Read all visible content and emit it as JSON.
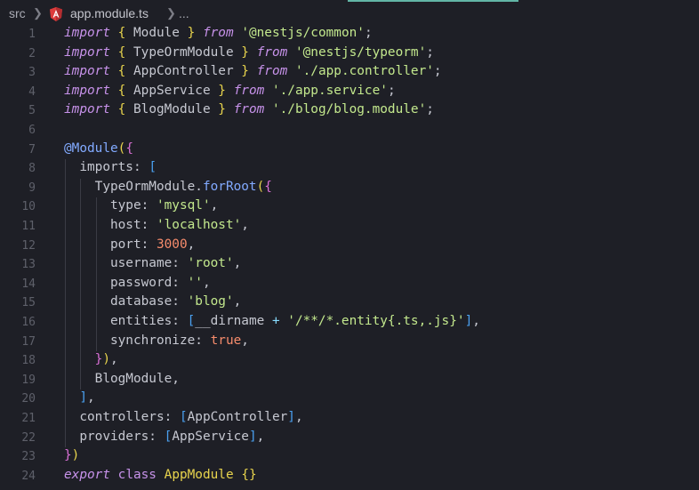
{
  "breadcrumb": {
    "folder": "src",
    "file": "app.module.ts",
    "ellipsis": "...",
    "file_icon": "angular-icon"
  },
  "colors": {
    "background": "#1e1f26",
    "accent": "#62b5a6",
    "keyword": "#c792ea",
    "string": "#c3e88d",
    "number": "#f78c6c",
    "bracket": "#e8d44d",
    "line_number": "#5e606a"
  },
  "editor": {
    "line_numbers": [
      "1",
      "2",
      "3",
      "4",
      "5",
      "6",
      "7",
      "8",
      "9",
      "10",
      "11",
      "12",
      "13",
      "14",
      "15",
      "16",
      "17",
      "18",
      "19",
      "20",
      "21",
      "22",
      "23",
      "24"
    ],
    "lines": [
      [
        [
          "kw",
          "import"
        ],
        [
          "punc",
          " "
        ],
        [
          "br",
          "{"
        ],
        [
          "punc",
          " Module "
        ],
        [
          "br",
          "}"
        ],
        [
          "punc",
          " "
        ],
        [
          "kw",
          "from"
        ],
        [
          "punc",
          " "
        ],
        [
          "str",
          "'@nestjs/common'"
        ],
        [
          "punc",
          ";"
        ]
      ],
      [
        [
          "kw",
          "import"
        ],
        [
          "punc",
          " "
        ],
        [
          "br",
          "{"
        ],
        [
          "punc",
          " TypeOrmModule "
        ],
        [
          "br",
          "}"
        ],
        [
          "punc",
          " "
        ],
        [
          "kw",
          "from"
        ],
        [
          "punc",
          " "
        ],
        [
          "str",
          "'@nestjs/typeorm'"
        ],
        [
          "punc",
          ";"
        ]
      ],
      [
        [
          "kw",
          "import"
        ],
        [
          "punc",
          " "
        ],
        [
          "br",
          "{"
        ],
        [
          "punc",
          " AppController "
        ],
        [
          "br",
          "}"
        ],
        [
          "punc",
          " "
        ],
        [
          "kw",
          "from"
        ],
        [
          "punc",
          " "
        ],
        [
          "str",
          "'./app.controller'"
        ],
        [
          "punc",
          ";"
        ]
      ],
      [
        [
          "kw",
          "import"
        ],
        [
          "punc",
          " "
        ],
        [
          "br",
          "{"
        ],
        [
          "punc",
          " AppService "
        ],
        [
          "br",
          "}"
        ],
        [
          "punc",
          " "
        ],
        [
          "kw",
          "from"
        ],
        [
          "punc",
          " "
        ],
        [
          "str",
          "'./app.service'"
        ],
        [
          "punc",
          ";"
        ]
      ],
      [
        [
          "kw",
          "import"
        ],
        [
          "punc",
          " "
        ],
        [
          "br",
          "{"
        ],
        [
          "punc",
          " BlogModule "
        ],
        [
          "br",
          "}"
        ],
        [
          "punc",
          " "
        ],
        [
          "kw",
          "from"
        ],
        [
          "punc",
          " "
        ],
        [
          "str",
          "'./blog/blog.module'"
        ],
        [
          "punc",
          ";"
        ]
      ],
      [],
      [
        [
          "deco",
          "@Module"
        ],
        [
          "br",
          "("
        ],
        [
          "br2",
          "{"
        ]
      ],
      [
        [
          "punc",
          "  imports: "
        ],
        [
          "br3",
          "["
        ]
      ],
      [
        [
          "punc",
          "    TypeOrmModule."
        ],
        [
          "fn",
          "forRoot"
        ],
        [
          "br",
          "("
        ],
        [
          "br2",
          "{"
        ]
      ],
      [
        [
          "punc",
          "      type: "
        ],
        [
          "str",
          "'mysql'"
        ],
        [
          "punc",
          ","
        ]
      ],
      [
        [
          "punc",
          "      host: "
        ],
        [
          "str",
          "'localhost'"
        ],
        [
          "punc",
          ","
        ]
      ],
      [
        [
          "punc",
          "      port: "
        ],
        [
          "num",
          "3000"
        ],
        [
          "punc",
          ","
        ]
      ],
      [
        [
          "punc",
          "      username: "
        ],
        [
          "str",
          "'root'"
        ],
        [
          "punc",
          ","
        ]
      ],
      [
        [
          "punc",
          "      password: "
        ],
        [
          "str",
          "''"
        ],
        [
          "punc",
          ","
        ]
      ],
      [
        [
          "punc",
          "      database: "
        ],
        [
          "str",
          "'blog'"
        ],
        [
          "punc",
          ","
        ]
      ],
      [
        [
          "punc",
          "      entities: "
        ],
        [
          "br3",
          "["
        ],
        [
          "punc",
          "__dirname "
        ],
        [
          "op",
          "+"
        ],
        [
          "punc",
          " "
        ],
        [
          "str",
          "'/**/*.entity{.ts,.js}'"
        ],
        [
          "br3",
          "]"
        ],
        [
          "punc",
          ","
        ]
      ],
      [
        [
          "punc",
          "      synchronize: "
        ],
        [
          "bool",
          "true"
        ],
        [
          "punc",
          ","
        ]
      ],
      [
        [
          "punc",
          "    "
        ],
        [
          "br2",
          "}"
        ],
        [
          "br",
          ")"
        ],
        [
          "punc",
          ","
        ]
      ],
      [
        [
          "punc",
          "    BlogModule,"
        ]
      ],
      [
        [
          "punc",
          "  "
        ],
        [
          "br3",
          "]"
        ],
        [
          "punc",
          ","
        ]
      ],
      [
        [
          "punc",
          "  controllers: "
        ],
        [
          "br3",
          "["
        ],
        [
          "punc",
          "AppController"
        ],
        [
          "br3",
          "]"
        ],
        [
          "punc",
          ","
        ]
      ],
      [
        [
          "punc",
          "  providers: "
        ],
        [
          "br3",
          "["
        ],
        [
          "punc",
          "AppService"
        ],
        [
          "br3",
          "]"
        ],
        [
          "punc",
          ","
        ]
      ],
      [
        [
          "br2",
          "}"
        ],
        [
          "br",
          ")"
        ]
      ],
      [
        [
          "kw",
          "export"
        ],
        [
          "punc",
          " "
        ],
        [
          "kw2",
          "class"
        ],
        [
          "punc",
          " "
        ],
        [
          "cls",
          "AppModule"
        ],
        [
          "punc",
          " "
        ],
        [
          "br",
          "{}"
        ]
      ]
    ]
  }
}
